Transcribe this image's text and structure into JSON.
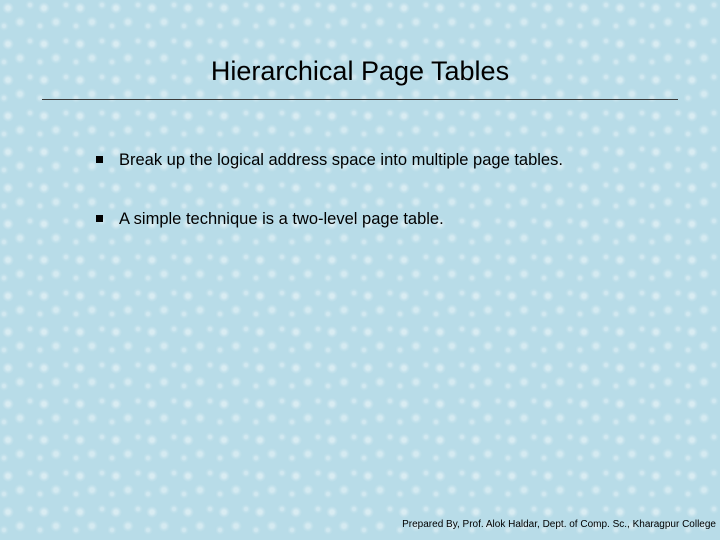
{
  "slide": {
    "title": "Hierarchical Page Tables",
    "bullets": [
      "Break up the logical address space into multiple page tables.",
      "A simple technique is a two-level page table."
    ],
    "footer": "Prepared By, Prof. Alok Haldar, Dept. of Comp. Sc., Kharagpur College"
  }
}
